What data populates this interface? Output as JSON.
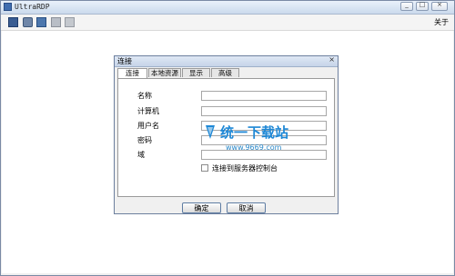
{
  "window": {
    "title": "UltraRDP",
    "min": "_",
    "max": "□",
    "close": "×"
  },
  "toolbar": {
    "about": "关于"
  },
  "dialog": {
    "title": "连接",
    "close": "×",
    "tabs": [
      "连接",
      "本地资源",
      "显示",
      "高级"
    ],
    "fields": [
      {
        "label": "名称",
        "value": ""
      },
      {
        "label": "计算机",
        "value": ""
      },
      {
        "label": "用户名",
        "value": ""
      },
      {
        "label": "密码",
        "value": ""
      },
      {
        "label": "域",
        "value": ""
      }
    ],
    "checkbox": {
      "label": "连接到服务器控制台",
      "checked": false
    },
    "ok": "确定",
    "cancel": "取消"
  },
  "watermark": {
    "name": "统一下载站",
    "url": "www.9669.com"
  }
}
